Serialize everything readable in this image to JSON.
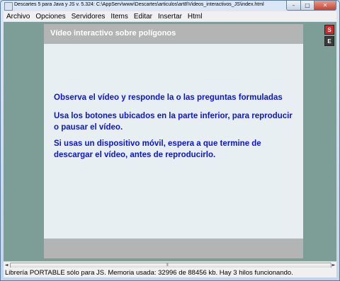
{
  "window": {
    "title": "Descartes 5 para Java y JS v. 5.324: C:\\AppServ\\www\\Descartes\\articulos\\art8\\Videos_interactivos_JS\\index.html",
    "buttons": {
      "minimize": "–",
      "maximize": "□",
      "close": "✕"
    }
  },
  "menu": {
    "items": [
      "Archivo",
      "Opciones",
      "Servidores",
      "Items",
      "Editar",
      "Insertar",
      "Html"
    ]
  },
  "scene": {
    "title": "Vídeo interactivo sobre polígonos",
    "paragraphs": [
      "Observa el vídeo  y responde la o las preguntas formuladas",
      "Usa los botones ubicados en la parte inferior, para reproducir o pausar el vídeo.",
      "Si usas un dispositivo móvil, espera a que termine de descargar el vídeo, antes de reproducirlo."
    ]
  },
  "side_buttons": {
    "s": "S",
    "e": "E"
  },
  "scrollbar": {
    "left_arrow": "◄",
    "right_arrow": "►",
    "grip": "⦀"
  },
  "status": "Librería PORTABLE sólo para JS. Memoria usada: 32996 de 88456 kb. Hay 3 hilos funcionando.",
  "colors": {
    "client_bg": "#7d9e96",
    "scene_bg": "#e8eff2",
    "header_bg": "#b3b5b5",
    "text_blue": "#0b14d6",
    "s_button": "#d0282b",
    "e_button": "#3a3a3a"
  }
}
